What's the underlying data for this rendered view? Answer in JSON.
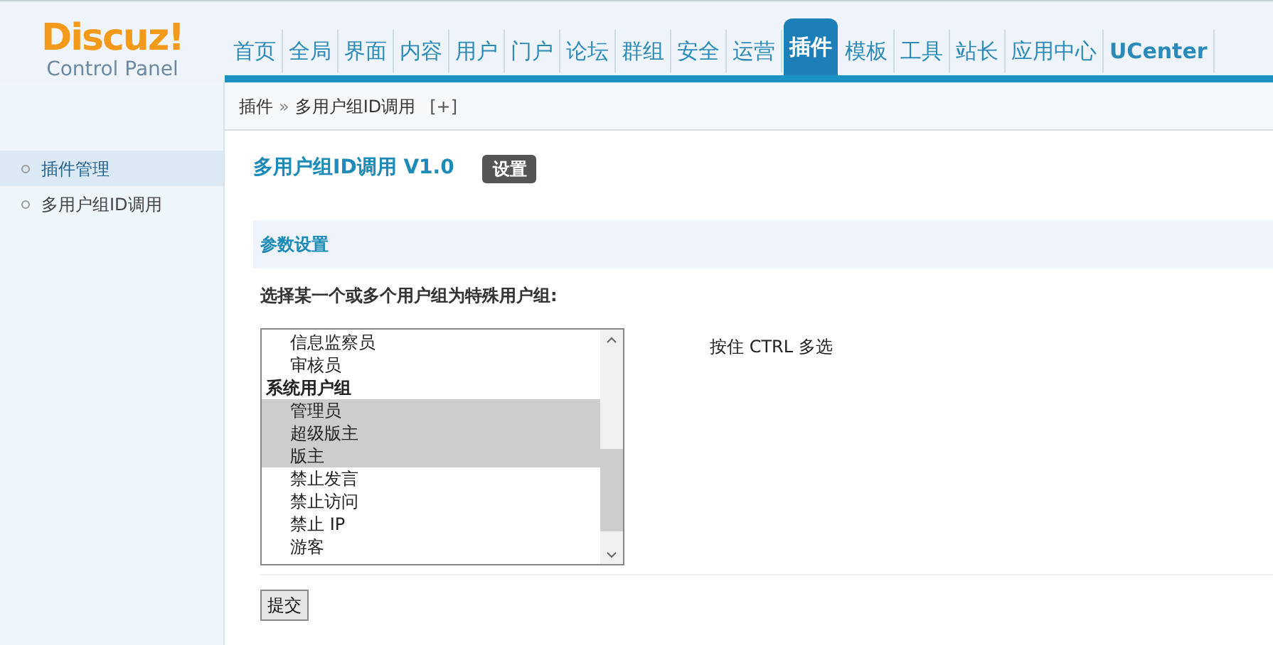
{
  "logo": {
    "brand": "Discuz!",
    "subtitle": "Control Panel"
  },
  "nav": [
    {
      "label": "首页",
      "selected": false
    },
    {
      "label": "全局",
      "selected": false
    },
    {
      "label": "界面",
      "selected": false
    },
    {
      "label": "内容",
      "selected": false
    },
    {
      "label": "用户",
      "selected": false
    },
    {
      "label": "门户",
      "selected": false
    },
    {
      "label": "论坛",
      "selected": false
    },
    {
      "label": "群组",
      "selected": false
    },
    {
      "label": "安全",
      "selected": false
    },
    {
      "label": "运营",
      "selected": false
    },
    {
      "label": "插件",
      "selected": true
    },
    {
      "label": "模板",
      "selected": false
    },
    {
      "label": "工具",
      "selected": false
    },
    {
      "label": "站长",
      "selected": false
    },
    {
      "label": "应用中心",
      "selected": false
    },
    {
      "label": "UCenter",
      "selected": false
    }
  ],
  "breadcrumb": {
    "items": [
      "插件",
      "多用户组ID调用"
    ],
    "separator": "»",
    "add": "[+]"
  },
  "sidebar": {
    "items": [
      {
        "label": "插件管理",
        "selected": true
      },
      {
        "label": "多用户组ID调用",
        "selected": false
      }
    ]
  },
  "page": {
    "title": "多用户组ID调用 V1.0",
    "badge": "设置"
  },
  "section": {
    "title": "参数设置"
  },
  "field": {
    "label": "选择某一个或多个用户组为特殊用户组:",
    "hint": "按住 CTRL 多选",
    "options": [
      {
        "kind": "option",
        "label": "信息监察员",
        "selected": false
      },
      {
        "kind": "option",
        "label": "审核员",
        "selected": false
      },
      {
        "kind": "group",
        "label": "系统用户组"
      },
      {
        "kind": "option",
        "label": "管理员",
        "selected": true
      },
      {
        "kind": "option",
        "label": "超级版主",
        "selected": true
      },
      {
        "kind": "option",
        "label": "版主",
        "selected": true
      },
      {
        "kind": "option",
        "label": "禁止发言",
        "selected": false
      },
      {
        "kind": "option",
        "label": "禁止访问",
        "selected": false
      },
      {
        "kind": "option",
        "label": "禁止 IP",
        "selected": false
      },
      {
        "kind": "option",
        "label": "游客",
        "selected": false
      }
    ]
  },
  "submit": "提交"
}
